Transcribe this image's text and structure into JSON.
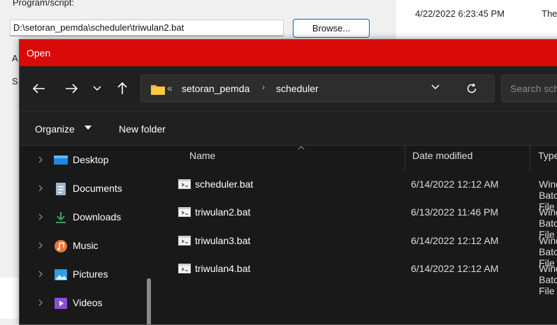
{
  "background": {
    "program_label": "Program/script:",
    "path_value": "D:\\setoran_pemda\\scheduler\\triwulan2.bat",
    "browse_label": "Browse...",
    "date_text": "4/22/2022 6:23:45 PM",
    "trailing_text": "The",
    "side_letter_1": "A",
    "side_letter_2": "S"
  },
  "dialog": {
    "title": "Open",
    "title_color": "#d80a0a",
    "address": {
      "overflow_marker": "«",
      "crumbs": [
        "setoran_pemda",
        "scheduler"
      ],
      "separator": "›"
    },
    "search_placeholder": "Search scheduler",
    "toolbar": {
      "organize": "Organize",
      "new_folder": "New folder"
    },
    "sidebar": [
      {
        "label": "Desktop",
        "icon": "desktop-icon"
      },
      {
        "label": "Documents",
        "icon": "documents-icon"
      },
      {
        "label": "Downloads",
        "icon": "downloads-icon"
      },
      {
        "label": "Music",
        "icon": "music-icon"
      },
      {
        "label": "Pictures",
        "icon": "pictures-icon"
      },
      {
        "label": "Videos",
        "icon": "videos-icon"
      }
    ],
    "columns": {
      "name": "Name",
      "date": "Date modified",
      "type": "Type"
    },
    "files": [
      {
        "name": "scheduler.bat",
        "date": "6/14/2022 12:12 AM",
        "type": "Windows Batch File"
      },
      {
        "name": "triwulan2.bat",
        "date": "6/13/2022 11:46 PM",
        "type": "Windows Batch File"
      },
      {
        "name": "triwulan3.bat",
        "date": "6/14/2022 12:12 AM",
        "type": "Windows Batch File"
      },
      {
        "name": "triwulan4.bat",
        "date": "6/14/2022 12:12 AM",
        "type": "Windows Batch File"
      }
    ]
  }
}
